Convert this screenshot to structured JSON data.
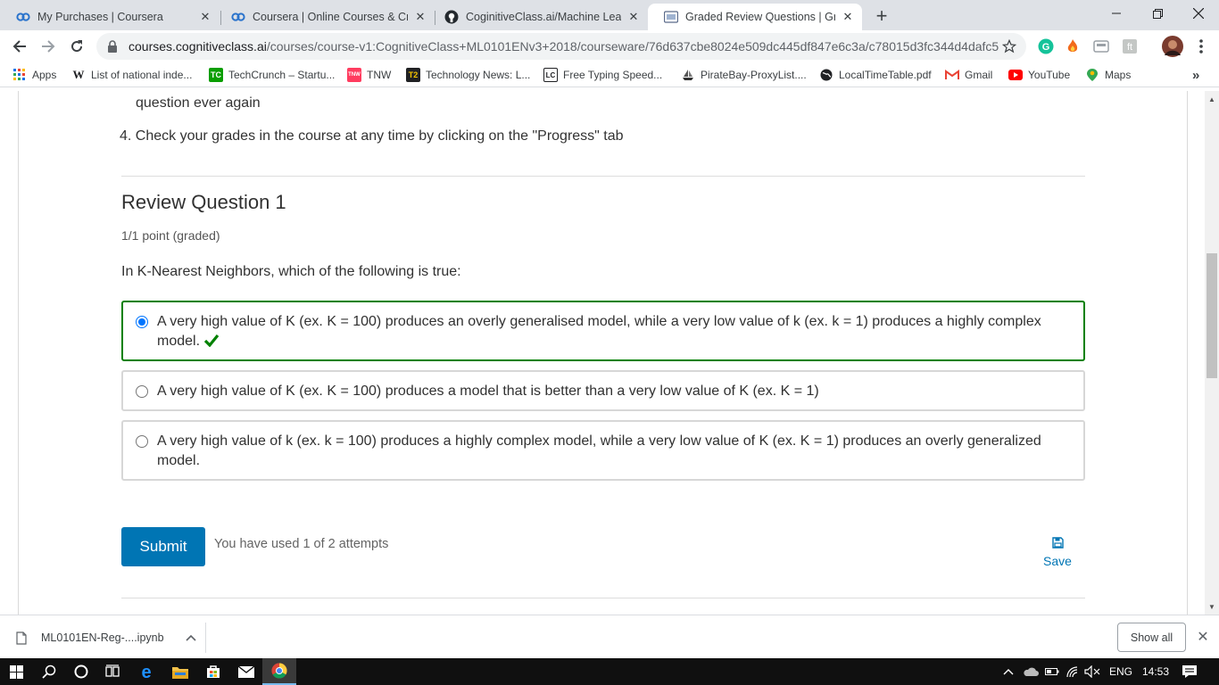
{
  "browser": {
    "tabs": [
      {
        "title": "My Purchases | Coursera",
        "favicon": "coursera-icon",
        "active": false
      },
      {
        "title": "Coursera | Online Courses & Cre",
        "favicon": "coursera-icon",
        "active": false
      },
      {
        "title": "CoginitiveClass.ai/Machine Learn",
        "favicon": "github-icon",
        "active": false
      },
      {
        "title": "Graded Review Questions | Grade",
        "favicon": "cognitiveclass-icon",
        "active": true
      }
    ],
    "new_tab_label": "+",
    "address": {
      "host": "courses.cognitiveclass.ai",
      "path": "/courses/course-v1:CognitiveClass+ML0101ENv3+2018/courseware/76d637cbe8024e509dc445df847e6c3a/c78015d3fc344d4dafc5..."
    },
    "bookmarks": [
      {
        "label": "Apps",
        "icon": "apps-grid-icon"
      },
      {
        "label": "List of national inde...",
        "icon": "wikipedia-icon"
      },
      {
        "label": "TechCrunch – Startu...",
        "icon": "techcrunch-icon"
      },
      {
        "label": "TNW",
        "icon": "tnw-icon"
      },
      {
        "label": "Technology News: L...",
        "icon": "t2-icon"
      },
      {
        "label": "Free Typing Speed...",
        "icon": "lc-icon"
      },
      {
        "label": "PirateBay-ProxyList....",
        "icon": "ship-icon"
      },
      {
        "label": "LocalTimeTable.pdf",
        "icon": "globe-icon"
      },
      {
        "label": "Gmail",
        "icon": "gmail-icon"
      },
      {
        "label": "YouTube",
        "icon": "youtube-icon"
      },
      {
        "label": "Maps",
        "icon": "maps-icon"
      }
    ],
    "bookmarks_overflow": "»"
  },
  "content": {
    "intro_tail": "question ever again",
    "intro_item4": "4. Check your grades in the course at any time by clicking on the \"Progress\" tab",
    "question": {
      "title": "Review Question 1",
      "points": "1/1 point (graded)",
      "prompt": "In K-Nearest Neighbors, which of the following is true:",
      "choices": [
        {
          "text": "A very high value of K (ex. K = 100) produces an overly generalised model, while a very low value of k (ex. k = 1) produces a highly complex model.",
          "selected": true,
          "correct": true
        },
        {
          "text": "A very high value of K (ex. K = 100) produces a model that is better than a very low value of K (ex. K = 1)",
          "selected": false,
          "correct": false
        },
        {
          "text": "A very high value of k (ex. k = 100) produces a highly complex model, while a very low value of K (ex. K = 1) produces an overly generalized model.",
          "selected": false,
          "correct": false
        }
      ]
    },
    "submit_label": "Submit",
    "attempts_text": "You have used 1 of 2 attempts",
    "save_label": "Save"
  },
  "downloads": {
    "file_name": "ML0101EN-Reg-....ipynb",
    "show_all_label": "Show all"
  },
  "taskbar": {
    "language": "ENG",
    "time": "14:53"
  },
  "colors": {
    "correct_border": "#008100",
    "submit_bg": "#0075b4",
    "link": "#0075b4"
  }
}
